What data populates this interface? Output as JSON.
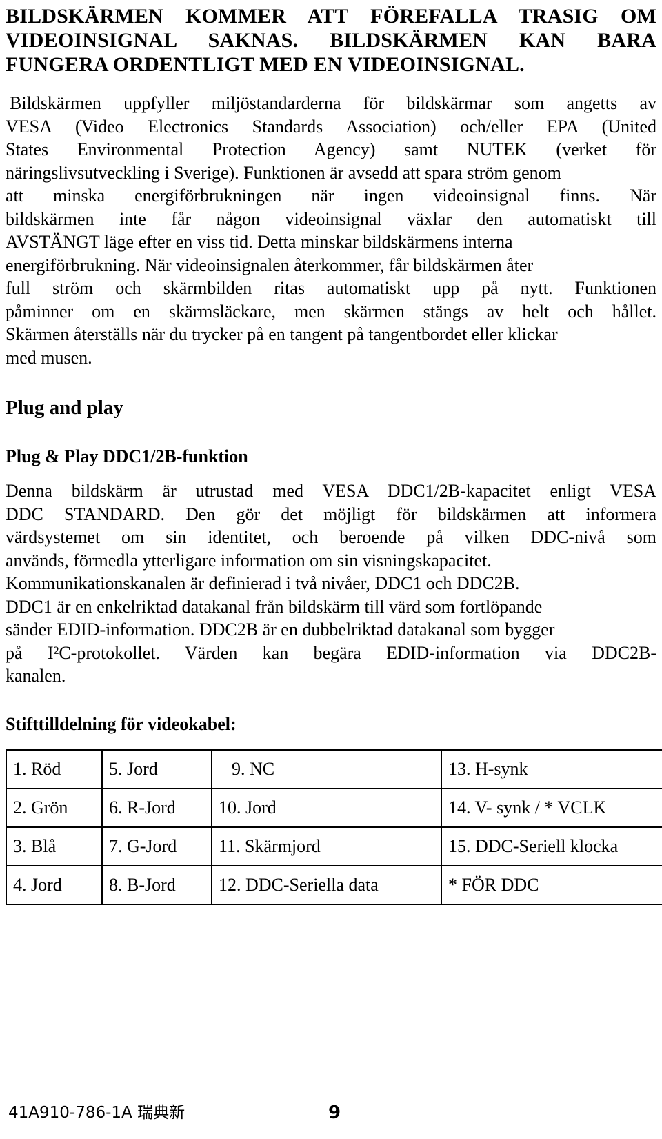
{
  "document": {
    "language": "sv",
    "caps_heading_lines": [
      "BILDSKÄRMEN KOMMER ATT FÖREFALLA TRASIG OM",
      "VIDEOINSIGNAL SAKNAS. BILDSKÄRMEN KAN BARA",
      "FUNGERA ORDENTLIGT MED EN VIDEOINSIGNAL."
    ],
    "intro_paragraph_lines": [
      "Bildskärmen uppfyller miljöstandarderna för bildskärmar som angetts av",
      "VESA (Video Electronics Standards Association) och/eller EPA (United",
      "States Environmental Protection Agency) samt NUTEK (verket för",
      "näringslivsutveckling i Sverige). Funktionen är avsedd att spara ström genom",
      "att minska energiförbrukningen när ingen videoinsignal finns. När",
      "bildskärmen inte får någon videoinsignal växlar den automatiskt till",
      "AVSTÄNGT läge efter en viss tid. Detta minskar bildskärmens interna",
      "energiförbrukning. När videoinsignalen återkommer, får bildskärmen åter",
      "full ström och skärmbilden ritas automatiskt upp på nytt. Funktionen",
      "påminner om en skärmsläckare, men skärmen stängs av helt och hållet.",
      "Skärmen återställs när du trycker på en tangent på tangentbordet eller klickar",
      "med musen."
    ],
    "plug_and_play_heading": "Plug and play",
    "ddc_function_heading": "Plug & Play DDC1/2B-funktion",
    "ddc_paragraph_lines": [
      "Denna bildskärm är utrustad med VESA DDC1/2B-kapacitet enligt VESA",
      "DDC STANDARD. Den gör det möjligt för bildskärmen att informera",
      "värdsystemet om sin identitet, och beroende på vilken DDC-nivå som",
      "används, förmedla ytterligare information om sin visningskapacitet.",
      "Kommunikationskanalen är definierad i två nivåer, DDC1 och DDC2B.",
      "DDC1 är en enkelriktad datakanal från bildskärm till värd som fortlöpande",
      "sänder EDID-information. DDC2B är en dubbelriktad datakanal som bygger",
      "på I²C-protokollet. Värden kan begära EDID-information via DDC2B-",
      "kanalen."
    ],
    "pin_assignment_heading": "Stifttilldelning för videokabel:",
    "pin_table": {
      "rows": [
        [
          "1. Röd",
          "5. Jord",
          "9. NC",
          "13. H-synk"
        ],
        [
          "2. Grön",
          "6. R-Jord",
          "10. Jord",
          "14. V- synk / * VCLK"
        ],
        [
          "3. Blå",
          "7. G-Jord",
          "11. Skärmjord",
          "15. DDC-Seriell klocka"
        ],
        [
          "4. Jord",
          "8. B-Jord",
          "12. DDC-Seriella data",
          "*  FÖR DDC"
        ]
      ]
    },
    "footer": {
      "document_code": "41A910-786-1A 瑞典新",
      "page_number": "9"
    }
  }
}
